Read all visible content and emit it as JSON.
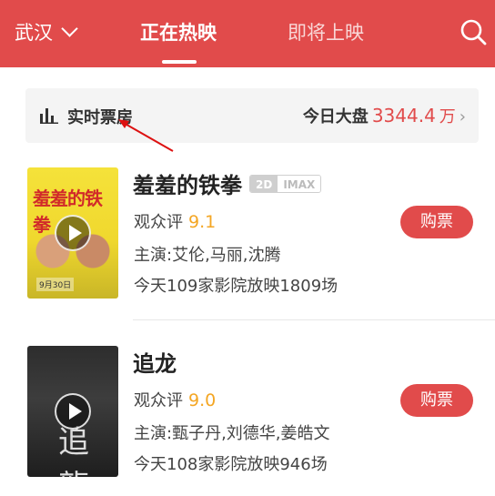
{
  "header": {
    "city": "武汉",
    "tabs": [
      {
        "label": "正在热映",
        "active": true
      },
      {
        "label": "即将上映",
        "active": false
      }
    ],
    "search_icon": "search-icon",
    "bg_color": "#e14b4b"
  },
  "box_office": {
    "label": "实时票房",
    "today_label": "今日大盘",
    "today_value": "3344.4",
    "today_unit": "万",
    "arrow": "›"
  },
  "movies": [
    {
      "title": "羞羞的铁拳",
      "badges": [
        "2D",
        "IMAX"
      ],
      "rating_label": "观众评",
      "rating": "9.1",
      "cast": "主演:艾伦,马丽,沈腾",
      "shows": "今天109家影院放映1809场",
      "buy_label": "购票",
      "poster_title": "羞羞的铁拳",
      "poster_date": "9月30日"
    },
    {
      "title": "追龙",
      "badges": [],
      "rating_label": "观众评",
      "rating": "9.0",
      "cast": "主演:甄子丹,刘德华,姜皓文",
      "shows": "今天108家影院放映946场",
      "buy_label": "购票",
      "poster_glyph": "追龍"
    }
  ],
  "colors": {
    "accent": "#e14b4b",
    "rating": "#f4a623"
  }
}
